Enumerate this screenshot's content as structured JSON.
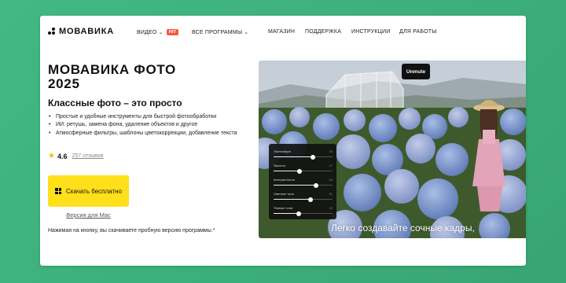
{
  "header": {
    "logo_text": "МОВАВИКА",
    "nav": [
      {
        "label": "ВИДЕО",
        "has_dropdown": true,
        "badge": "HIT"
      },
      {
        "label": "ВСЕ ПРОГРАММЫ",
        "has_dropdown": true
      },
      {
        "label": "МАГАЗИН"
      },
      {
        "label": "ПОДДЕРЖКА"
      },
      {
        "label": "ИНСТРУКЦИИ"
      },
      {
        "label": "ДЛЯ РАБОТЫ"
      }
    ]
  },
  "product": {
    "title_line1": "МОВАВИКА ФОТО",
    "title_line2": "2025",
    "subtitle": "Классные фото – это просто",
    "features": [
      "Простые и удобные инструменты для быстрой фотообработки",
      "ИИ: ретушь, замена фона, удаление объектов и другое",
      "Атмосферные фильтры, шаблоны цветокоррекции, добавление текста"
    ],
    "rating": "4.6",
    "reviews": "257 отзывов",
    "download_label": "Скачать бесплатно",
    "mac_label": "Версия для Mac",
    "disclaimer": "Нажимая на кнопку, вы скачиваете пробную версию программы.*"
  },
  "hero": {
    "unmute_label": "Unmute",
    "caption": "Легко создавайте сочные кадры,",
    "sliders": [
      {
        "label": "Экспозиция",
        "value": "33",
        "fraction": 0.66
      },
      {
        "label": "Яркость",
        "value": "17",
        "fraction": 0.44
      },
      {
        "label": "Контрастность",
        "value": "43",
        "fraction": 0.72
      },
      {
        "label": "Светлые тона",
        "value": "31",
        "fraction": 0.62
      },
      {
        "label": "Темные тона",
        "value": "15",
        "fraction": 0.42
      }
    ]
  },
  "colors": {
    "page_background": "#3cae7a",
    "download_button": "#ffe01a",
    "hit_badge": "#f25a3c",
    "rating_star": "#f3c300"
  },
  "icons": {
    "logo": "movavi-logo-dots",
    "dropdown": "chevron-down-icon",
    "star": "star-icon",
    "windows": "windows-icon"
  }
}
